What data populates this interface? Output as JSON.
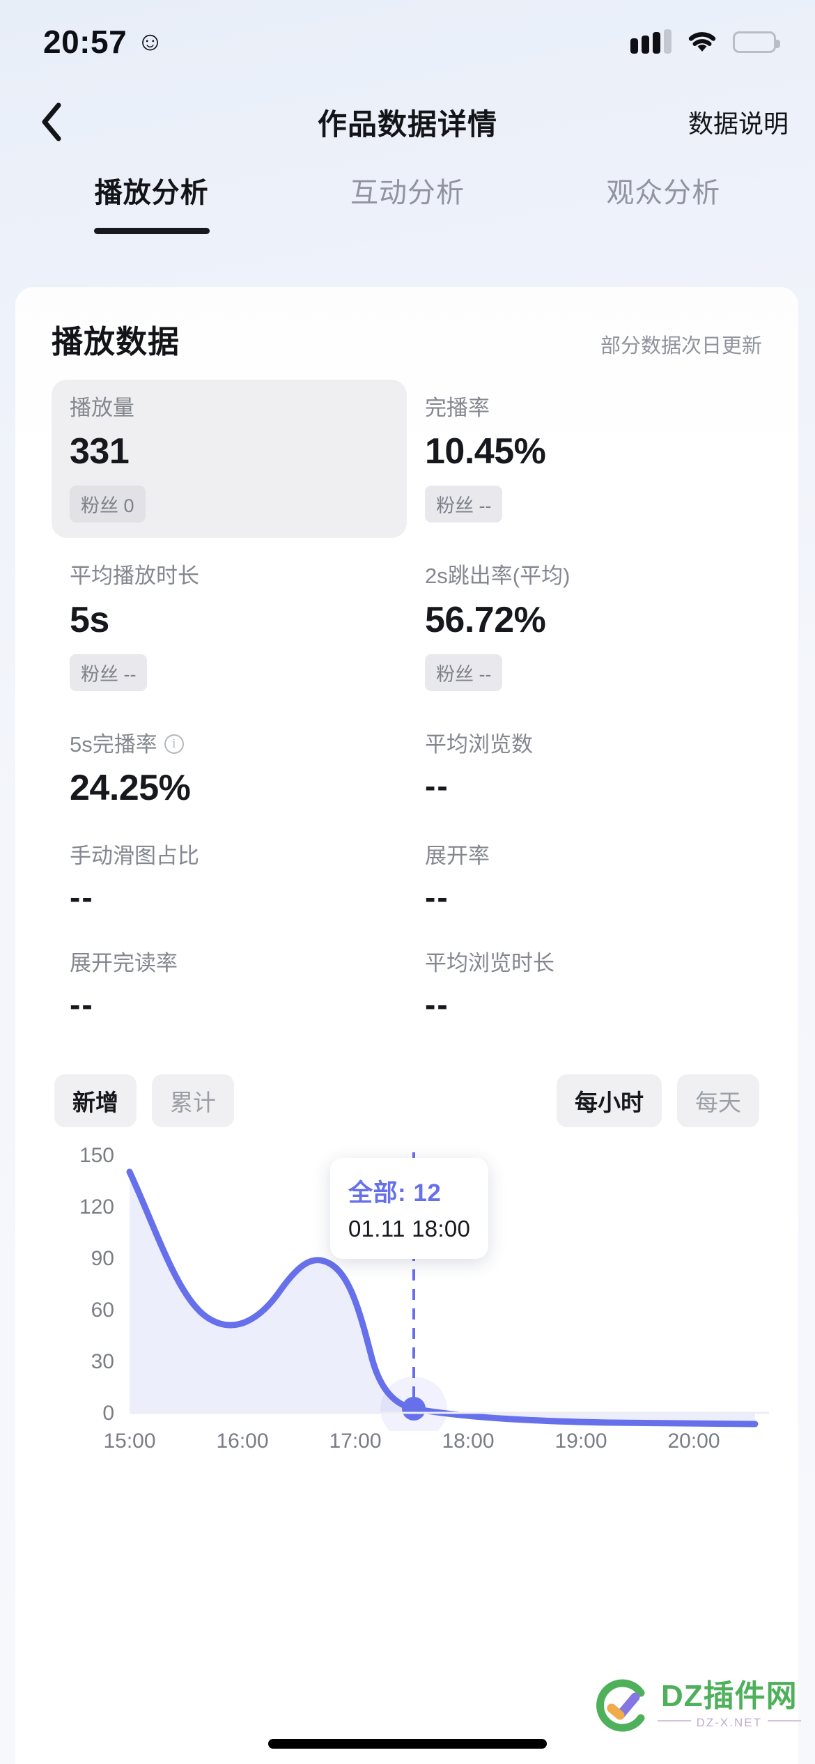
{
  "status_bar": {
    "time": "20:57",
    "emoji": "☺",
    "signal_icon": "signal-bars-icon",
    "wifi_icon": "wifi-icon",
    "battery_icon": "battery-full-icon"
  },
  "nav": {
    "back_icon": "chevron-left-icon",
    "title": "作品数据详情",
    "action_label": "数据说明"
  },
  "tabs": [
    {
      "label": "播放分析",
      "active": true
    },
    {
      "label": "互动分析",
      "active": false
    },
    {
      "label": "观众分析",
      "active": false
    }
  ],
  "section": {
    "title": "播放数据",
    "note": "部分数据次日更新"
  },
  "metrics": [
    {
      "label": "播放量",
      "value": "331",
      "sub": "粉丝 0",
      "highlighted": true,
      "info": false
    },
    {
      "label": "完播率",
      "value": "10.45%",
      "sub": "粉丝 --",
      "highlighted": false,
      "info": false
    },
    {
      "label": "平均播放时长",
      "value": "5s",
      "sub": "粉丝 --",
      "highlighted": false,
      "info": false
    },
    {
      "label": "2s跳出率(平均)",
      "value": "56.72%",
      "sub": "粉丝 --",
      "highlighted": false,
      "info": false
    },
    {
      "label": "5s完播率",
      "value": "24.25%",
      "sub": "",
      "highlighted": false,
      "info": true
    },
    {
      "label": "平均浏览数",
      "value": "--",
      "sub": "",
      "highlighted": false,
      "info": false
    },
    {
      "label": "手动滑图占比",
      "value": "--",
      "sub": "",
      "highlighted": false,
      "info": false
    },
    {
      "label": "展开率",
      "value": "--",
      "sub": "",
      "highlighted": false,
      "info": false
    },
    {
      "label": "展开完读率",
      "value": "--",
      "sub": "",
      "highlighted": false,
      "info": false
    },
    {
      "label": "平均浏览时长",
      "value": "--",
      "sub": "",
      "highlighted": false,
      "info": false
    }
  ],
  "chart_toggles": {
    "left": [
      {
        "label": "新增",
        "active": true
      },
      {
        "label": "累计",
        "active": false
      }
    ],
    "right": [
      {
        "label": "每小时",
        "active": true
      },
      {
        "label": "每天",
        "active": false
      }
    ]
  },
  "tooltip": {
    "series_label": "全部: 12",
    "timestamp": "01.11 18:00"
  },
  "colors": {
    "line": "#6670ea",
    "area": "#eceefb",
    "accent": "#6670ea",
    "text_primary": "#16181d",
    "text_muted": "#84878f"
  },
  "watermark": {
    "main": "DZ插件网",
    "sub": "DZ-X.NET"
  },
  "chart_data": {
    "type": "line",
    "title": "",
    "xlabel": "",
    "ylabel": "",
    "x": [
      "15:00",
      "16:00",
      "17:00",
      "18:00",
      "19:00",
      "20:00"
    ],
    "y_ticks": [
      0,
      30,
      60,
      90,
      120,
      150
    ],
    "ylim": [
      0,
      150
    ],
    "grid": false,
    "legend": "none",
    "series": [
      {
        "name": "全部",
        "values": [
          143,
          68,
          96,
          12,
          5,
          3
        ]
      }
    ],
    "highlight_point": {
      "x": "18:00",
      "y": 12,
      "label": "全部: 12",
      "timestamp": "01.11 18:00"
    }
  }
}
